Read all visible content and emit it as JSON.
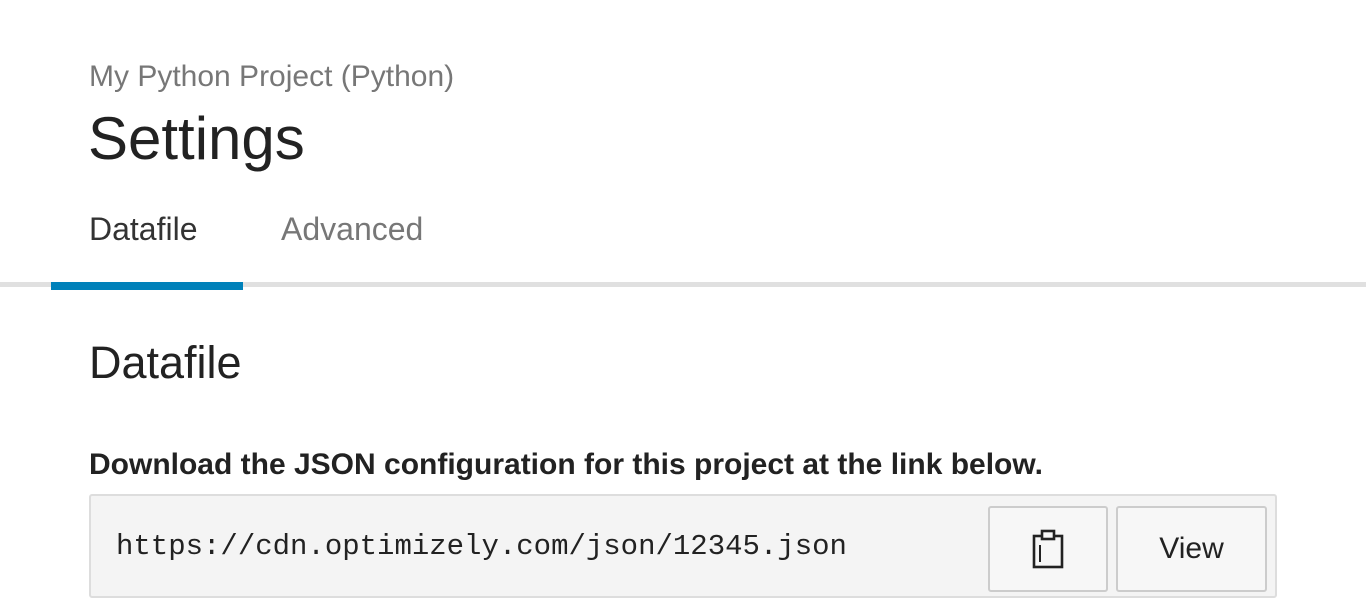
{
  "header": {
    "project_name": "My Python Project (Python)",
    "title": "Settings"
  },
  "tabs": [
    {
      "label": "Datafile",
      "active": true
    },
    {
      "label": "Advanced",
      "active": false
    }
  ],
  "section": {
    "heading": "Datafile",
    "description": "Download the JSON configuration for this project at the link below.",
    "url": "https://cdn.optimizely.com/json/12345.json",
    "copy_icon": "clipboard-icon",
    "view_label": "View"
  },
  "colors": {
    "accent": "#0081ba",
    "muted_text": "#777777",
    "text": "#222222",
    "field_bg": "#f4f4f4"
  }
}
